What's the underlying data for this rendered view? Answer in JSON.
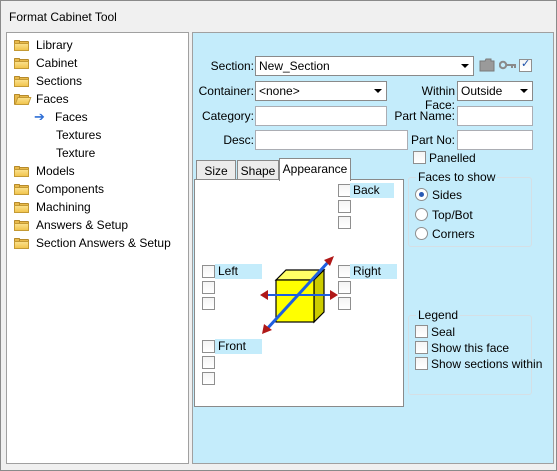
{
  "window": {
    "title": "Format Cabinet Tool"
  },
  "tree": {
    "items": [
      {
        "label": "Library",
        "icon": "folder-icon"
      },
      {
        "label": "Cabinet",
        "icon": "folder-icon"
      },
      {
        "label": "Sections",
        "icon": "folder-icon"
      },
      {
        "label": "Faces",
        "icon": "open-folder-icon"
      },
      {
        "label": "Faces",
        "icon": "arrow-right-icon"
      },
      {
        "label": "Textures",
        "icon": ""
      },
      {
        "label": "Texture",
        "icon": ""
      },
      {
        "label": "Models",
        "icon": "folder-icon"
      },
      {
        "label": "Components",
        "icon": "folder-icon"
      },
      {
        "label": "Machining",
        "icon": "folder-icon"
      },
      {
        "label": "Answers & Setup",
        "icon": "folder-icon"
      },
      {
        "label": "Section Answers & Setup",
        "icon": "folder-icon"
      }
    ]
  },
  "form": {
    "section_label": "Section:",
    "section_value": "New_Section",
    "section_checked": true,
    "container_label": "Container:",
    "container_value": "<none>",
    "within_face_label": "Within Face:",
    "within_face_value": "Outside",
    "category_label": "Category:",
    "category_value": "",
    "part_name_label": "Part Name:",
    "part_name_value": "",
    "desc_label": "Desc:",
    "desc_value": "",
    "part_no_label": "Part No:",
    "part_no_value": "",
    "panelled_label": "Panelled",
    "panelled_checked": false
  },
  "faces_to_show": {
    "title": "Faces to show",
    "options": [
      "Sides",
      "Top/Bot",
      "Corners"
    ],
    "selected": "Sides"
  },
  "legend": {
    "title": "Legend",
    "items": [
      {
        "label": "Seal",
        "checked": false
      },
      {
        "label": "Show this face",
        "checked": false
      },
      {
        "label": "Show sections within",
        "checked": false
      }
    ]
  },
  "tabs": {
    "items": [
      "Size",
      "Shape",
      "Appearance"
    ],
    "active": "Appearance"
  },
  "appearance": {
    "back_label": "Back",
    "left_label": "Left",
    "right_label": "Right",
    "front_label": "Front"
  },
  "colors": {
    "panel_bg": "#c4ecfb",
    "cube_yellow": "#ffff00",
    "arrow_blue": "#1e5fe0",
    "arrow_head": "#b01818"
  }
}
